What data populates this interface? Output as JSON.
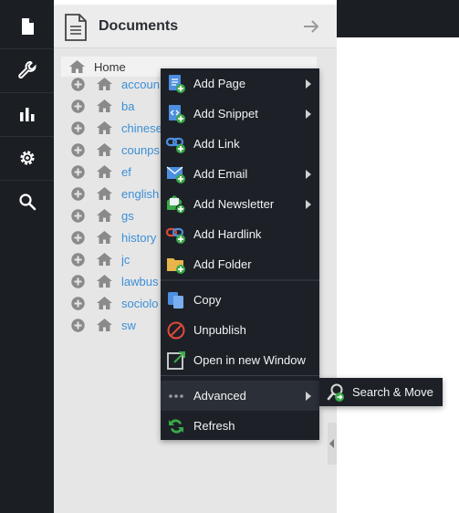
{
  "rail": {
    "items": [
      {
        "icon": "document-icon"
      },
      {
        "icon": "wrench-icon"
      },
      {
        "icon": "bar-chart-icon"
      },
      {
        "icon": "gear-icon"
      },
      {
        "icon": "search-icon"
      }
    ]
  },
  "panel": {
    "title": "Documents",
    "home_label": "Home",
    "tree_items": [
      "accoun",
      "ba",
      "chinese",
      "counps",
      "ef",
      "english",
      "gs",
      "history",
      "jc",
      "lawbus",
      "sociolo",
      "sw"
    ]
  },
  "context_menu": {
    "items": [
      {
        "label": "Add Page",
        "icon": "add-page-icon",
        "submenu": true
      },
      {
        "label": "Add Snippet",
        "icon": "add-snippet-icon",
        "submenu": true
      },
      {
        "label": "Add Link",
        "icon": "add-link-icon",
        "submenu": false
      },
      {
        "label": "Add Email",
        "icon": "add-email-icon",
        "submenu": true
      },
      {
        "label": "Add Newsletter",
        "icon": "add-newsletter-icon",
        "submenu": true
      },
      {
        "label": "Add Hardlink",
        "icon": "add-hardlink-icon",
        "submenu": false
      },
      {
        "label": "Add Folder",
        "icon": "add-folder-icon",
        "submenu": false
      },
      {
        "label": "Copy",
        "icon": "copy-icon",
        "submenu": false
      },
      {
        "label": "Unpublish",
        "icon": "unpublish-icon",
        "submenu": false
      },
      {
        "label": "Open in new Window",
        "icon": "open-window-icon",
        "submenu": false
      },
      {
        "label": "Advanced",
        "icon": "more-icon",
        "submenu": true,
        "active": true
      },
      {
        "label": "Refresh",
        "icon": "refresh-icon",
        "submenu": false
      }
    ]
  },
  "advanced_submenu": {
    "items": [
      {
        "label": "Search & Move",
        "icon": "search-move-icon"
      }
    ]
  },
  "colors": {
    "rail_bg": "#1b1f24",
    "menu_bg": "#1d2127",
    "link_blue": "#3b8fd6",
    "accent_green": "#3aa94a"
  }
}
